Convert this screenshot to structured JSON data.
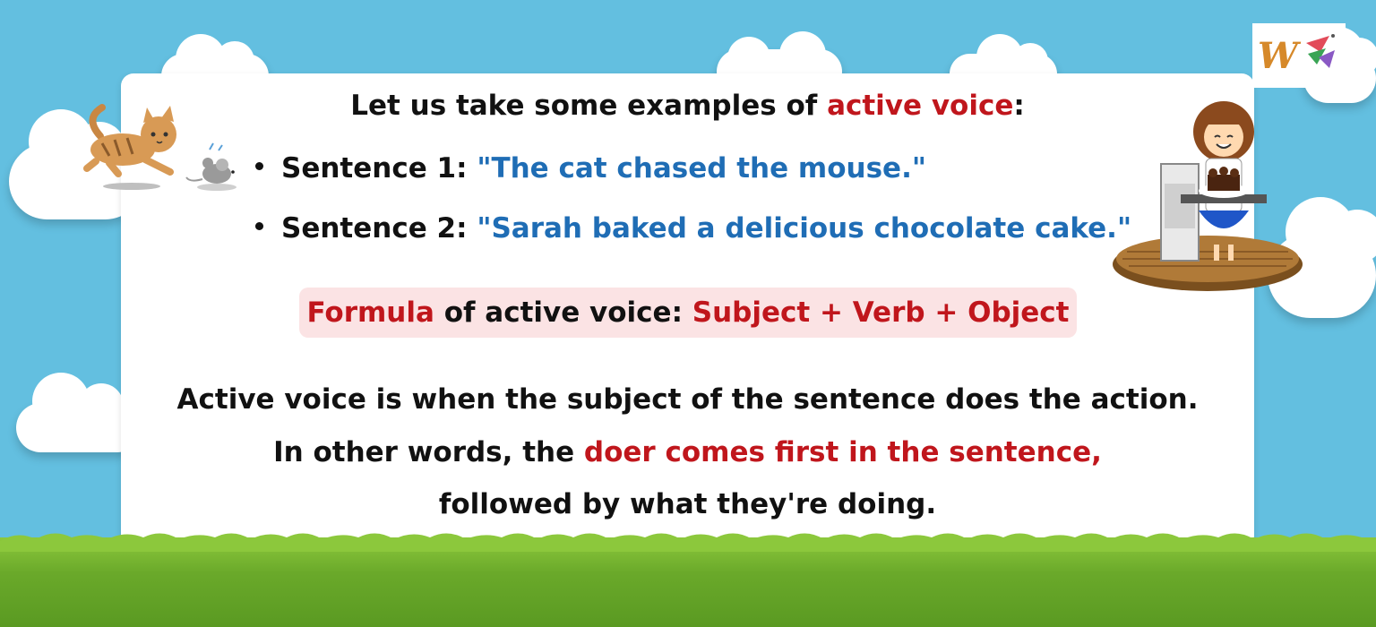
{
  "heading": {
    "before": "Let us take some examples of ",
    "highlight": "active voice",
    "after": ":"
  },
  "examples": [
    {
      "label": "Sentence 1",
      "separator": ": ",
      "text": "\"The cat chased the mouse.\""
    },
    {
      "label": "Sentence 2",
      "separator": ": ",
      "text": "\"Sarah baked a delicious chocolate cake.\""
    }
  ],
  "formula": {
    "word": "Formula",
    "middle": " of active voice: ",
    "value": "Subject + Verb + Object"
  },
  "explanation": {
    "line1": "Active voice is when the subject of the sentence does the action.",
    "line2_plain": "In other words, the ",
    "line2_highlight": "doer comes first in the sentence,",
    "line3": "followed by what they're doing."
  },
  "colors": {
    "red": "#c0161c",
    "blue": "#1f6db5",
    "sky": "#63bfe0",
    "formula_bg": "#fbe3e4"
  },
  "icons": [
    "brand-logo-icon",
    "cat-chasing-mouse-illustration",
    "girl-with-cake-illustration"
  ]
}
